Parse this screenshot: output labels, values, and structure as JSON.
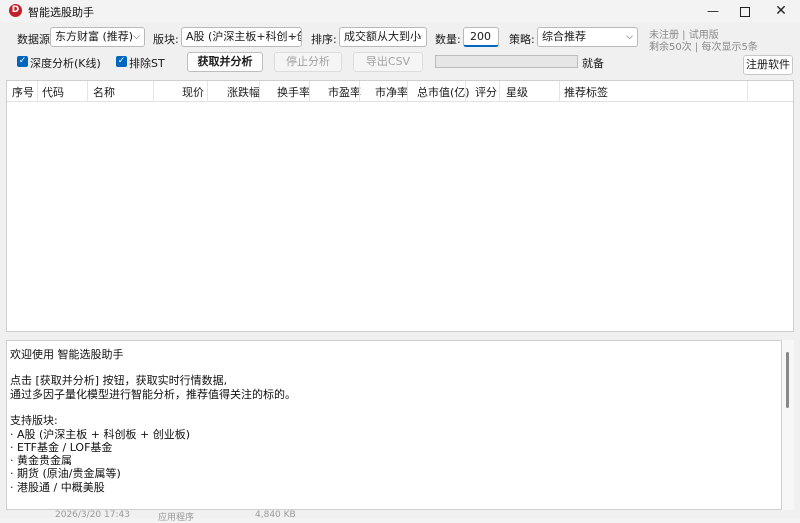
{
  "window": {
    "title": "智能选股助手",
    "app_icon": "D",
    "controls": {
      "minimize": "—",
      "close": "✕"
    }
  },
  "toolbar": {
    "datasource_label": "数据源:",
    "datasource_value": "东方财富 (推荐)",
    "sector_label": "版块:",
    "sector_value": "A股 (沪深主板+科创+创'",
    "sort_label": "排序:",
    "sort_value": "成交额从大到小",
    "count_label": "数量:",
    "count_value": "200",
    "strategy_label": "策略:",
    "strategy_value": "综合推荐",
    "deep_analysis_label": "深度分析(K线)",
    "exclude_st_label": "排除ST",
    "fetch_button": "获取并分析",
    "stop_button": "停止分析",
    "export_button": "导出CSV",
    "progress": 0,
    "status": "就备",
    "register_button": "注册软件",
    "reg_status_line1": "未注册 | 试用版",
    "reg_status_line2": "剩余50次 | 每次显示5条"
  },
  "table": {
    "columns": [
      "序号",
      "代码",
      "名称",
      "现价",
      "涨跌幅",
      "换手率",
      "市盈率",
      "市净率",
      "总市值(亿)",
      "评分",
      "星级",
      "推荐标签"
    ],
    "rows": []
  },
  "log": {
    "lines": [
      "欢迎使用 智能选股助手",
      "",
      "点击 [获取并分析] 按钮，获取实时行情数据,",
      "通过多因子量化模型进行智能分析，推荐值得关注的标的。",
      "",
      "支持版块:",
      " · A股 (沪深主板 + 科创板 + 创业板)",
      " · ETF基金 / LOF基金",
      " · 黄金贵金属",
      " · 期货 (原油/贵金属等)",
      " · 港股通 / 中概美股"
    ]
  },
  "background_peek": {
    "date": "2026/3/20 17:43",
    "type": "应用程序",
    "size": "4,840 KB"
  }
}
